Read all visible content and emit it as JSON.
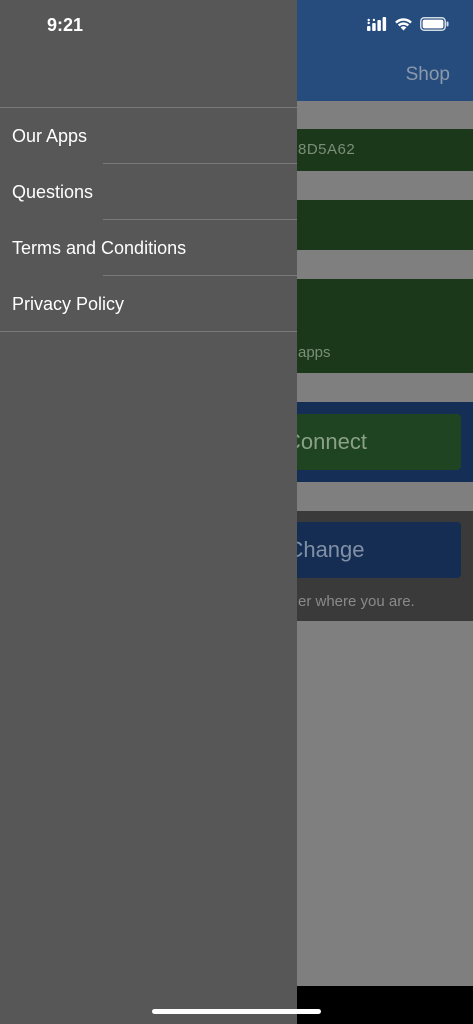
{
  "status_bar": {
    "time": "9:21",
    "icons": [
      "signal-icon",
      "wifi-icon",
      "battery-icon"
    ]
  },
  "background": {
    "nav_shop_label": "Shop",
    "device_id_fragment": "8D5A62",
    "apps_fragment": "apps",
    "connect_label": "Connect",
    "change_label": "Change",
    "change_hint_fragment": "er where you are."
  },
  "drawer": {
    "items": [
      {
        "label": "Our Apps"
      },
      {
        "label": "Questions"
      },
      {
        "label": "Terms and Conditions"
      },
      {
        "label": "Privacy Policy"
      }
    ]
  },
  "colors": {
    "drawer_bg": "#575757",
    "nav_bg": "#264c7d",
    "green_card": "#1b381a",
    "blue_panel": "#142e55"
  }
}
